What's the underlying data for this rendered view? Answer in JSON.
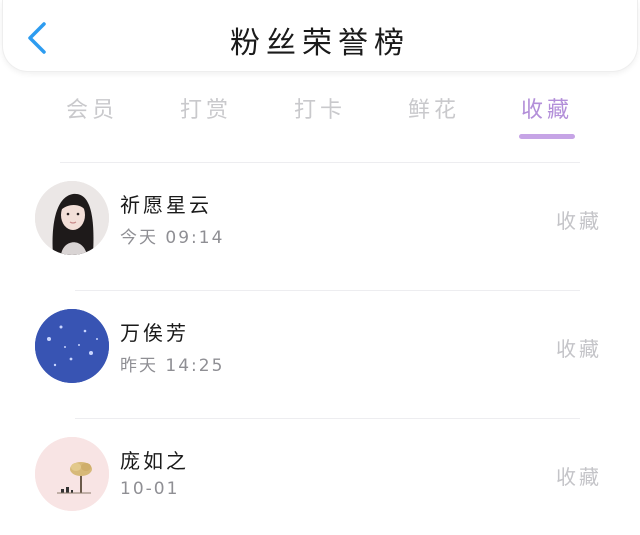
{
  "header": {
    "title": "粉丝荣誉榜",
    "back_icon": "chevron-left-icon",
    "back_color": "#2d9cf0"
  },
  "tabs": [
    {
      "label": "会员",
      "active": false
    },
    {
      "label": "打赏",
      "active": false
    },
    {
      "label": "打卡",
      "active": false
    },
    {
      "label": "鲜花",
      "active": false
    },
    {
      "label": "收藏",
      "active": true
    }
  ],
  "colors": {
    "accent": "#b38fd9",
    "inactive_tab": "#c9c9cc"
  },
  "fans": [
    {
      "name": "祈愿星云",
      "time": "今天 09:14",
      "action": "收藏",
      "avatar": "portrait-photo"
    },
    {
      "name": "万俟芳",
      "time": "昨天 14:25",
      "action": "收藏",
      "avatar": "blue-snow"
    },
    {
      "name": "庞如之",
      "time": "10-01",
      "action": "收藏",
      "avatar": "tree-illustration"
    }
  ]
}
